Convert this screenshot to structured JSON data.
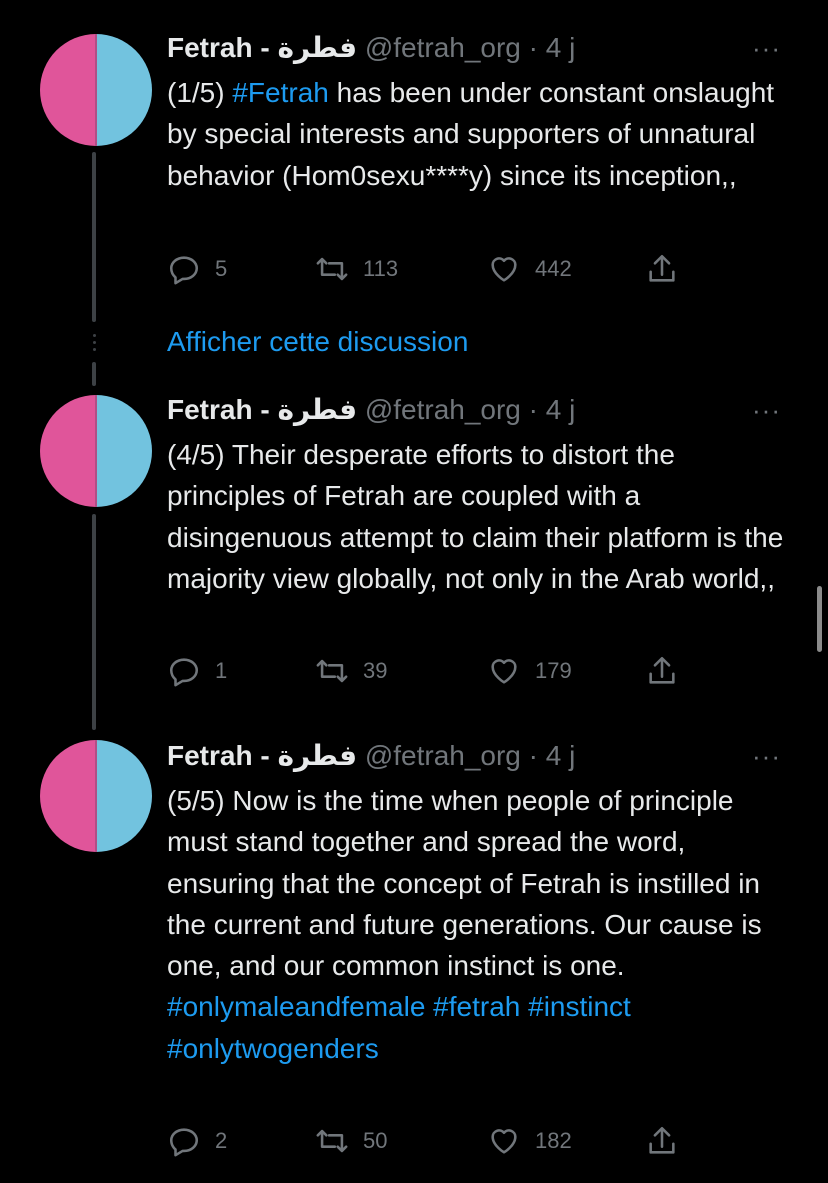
{
  "tweets": [
    {
      "name": "Fetrah - فطرة",
      "handle": "@fetrah_org",
      "time": "· 4 j",
      "more": "···",
      "text_before": "(1/5) ",
      "hashtag": "#Fetrah",
      "text_after": " has been under constant onslaught by special interests and supporters of unnatural behavior (Hom0sexu****y) since its inception,,",
      "replies": "5",
      "retweets": "113",
      "likes": "442"
    },
    {
      "name": "Fetrah - فطرة",
      "handle": "@fetrah_org",
      "time": "· 4 j",
      "more": "···",
      "text": "(4/5) Their desperate efforts to distort the principles of Fetrah are coupled with a disingenuous attempt to claim their platform is the majority view globally, not only in the Arab world,,",
      "replies": "1",
      "retweets": "39",
      "likes": "179"
    },
    {
      "name": "Fetrah - فطرة",
      "handle": "@fetrah_org",
      "time": "· 4 j",
      "more": "···",
      "text": "(5/5) Now is the time when people of principle must stand together and spread the word, ensuring that the concept of Fetrah is instilled in the current and future generations. Our cause is one, and our common instinct is one.",
      "hashtags_line1": "#onlymaleandfemale #fetrah #instinct",
      "hashtags_line2": "#onlytwogenders",
      "replies": "2",
      "retweets": "50",
      "likes": "182"
    }
  ],
  "show_thread": "Afficher cette discussion",
  "icons": [
    "reply-icon",
    "retweet-icon",
    "like-icon",
    "share-icon",
    "more-icon"
  ],
  "colors": {
    "accent": "#1d9bf0",
    "muted": "#71767b",
    "avatar_pink": "#e0559a",
    "avatar_blue": "#72c3df"
  }
}
